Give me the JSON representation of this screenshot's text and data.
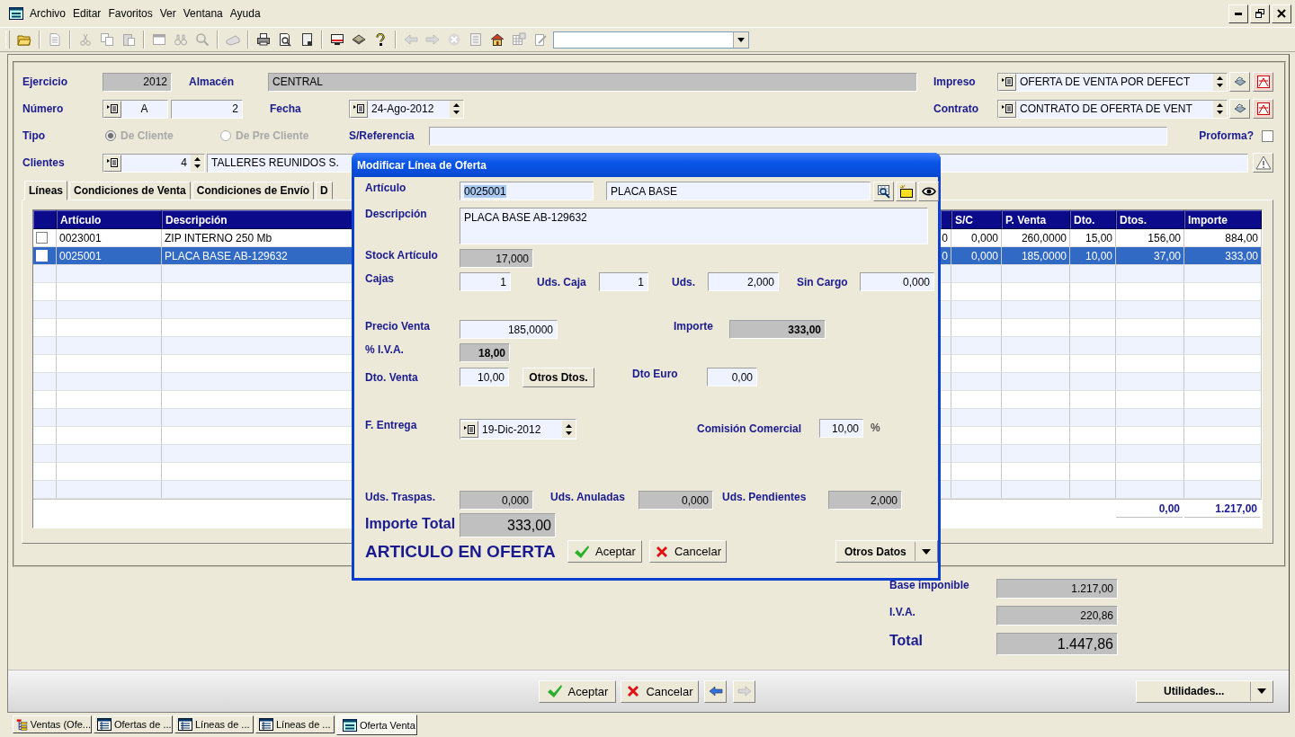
{
  "menu_bar": {
    "items": [
      "Archivo",
      "Editar",
      "Favoritos",
      "Ver",
      "Ventana",
      "Ayuda"
    ]
  },
  "toolbar": {
    "groups": [
      [
        {
          "kind": "open",
          "disabled": false
        }
      ],
      [
        {
          "kind": "doc",
          "disabled": true
        }
      ],
      [
        {
          "kind": "cut",
          "disabled": true
        },
        {
          "kind": "copy",
          "disabled": true
        },
        {
          "kind": "paste",
          "disabled": true
        }
      ],
      [
        {
          "kind": "window",
          "disabled": true
        },
        {
          "kind": "replace",
          "disabled": true
        },
        {
          "kind": "search",
          "disabled": true
        }
      ],
      [
        {
          "kind": "scanner",
          "disabled": true
        }
      ],
      [
        {
          "kind": "print",
          "disabled": false
        },
        {
          "kind": "preview",
          "disabled": false
        },
        {
          "kind": "page",
          "disabled": false
        }
      ],
      [
        {
          "kind": "monitor",
          "disabled": false
        },
        {
          "kind": "book",
          "disabled": false
        },
        {
          "kind": "help",
          "disabled": false
        }
      ],
      [
        {
          "kind": "back",
          "disabled": true
        },
        {
          "kind": "forward",
          "disabled": true
        },
        {
          "kind": "stop",
          "disabled": true
        },
        {
          "kind": "refresh",
          "disabled": true
        },
        {
          "kind": "home",
          "disabled": false
        },
        {
          "kind": "grid",
          "disabled": true
        },
        {
          "kind": "edit",
          "disabled": true
        }
      ]
    ]
  },
  "header": {
    "ejercicio": {
      "label": "Ejercicio",
      "value": "2012"
    },
    "almacen": {
      "label": "Almacén",
      "value": "CENTRAL"
    },
    "impreso": {
      "label": "Impreso",
      "value": "OFERTA DE VENTA POR DEFECT"
    },
    "numero": {
      "label": "Número",
      "serie": "A",
      "value": "2"
    },
    "fecha": {
      "label": "Fecha",
      "value": "24-Ago-2012"
    },
    "contrato": {
      "label": "Contrato",
      "value": "CONTRATO DE OFERTA DE VENT"
    },
    "tipo": {
      "label": "Tipo",
      "options": [
        {
          "label": "De Cliente",
          "selected": true,
          "disabled": true
        },
        {
          "label": "De Pre Cliente",
          "selected": false,
          "disabled": true
        }
      ]
    },
    "referencia": {
      "label": "S/Referencia"
    },
    "proforma": {
      "label": "Proforma?",
      "checked": false
    },
    "clientes": {
      "label": "Clientes",
      "code": "4",
      "name": "TALLERES REUNIDOS S."
    }
  },
  "tabs": [
    {
      "label": "Líneas",
      "selected": true
    },
    {
      "label": "Condiciones de Venta",
      "selected": false
    },
    {
      "label": "Condiciones de Envío",
      "selected": false
    },
    {
      "label": "D",
      "selected": false
    }
  ],
  "table": {
    "columns": [
      {
        "kind": "full",
        "label": "Artículo"
      },
      {
        "kind": "full",
        "label": "Descripción"
      },
      {
        "kind": "cut"
      },
      {
        "kind": "full",
        "label": "S/C"
      },
      {
        "kind": "full",
        "label": "P. Venta"
      },
      {
        "kind": "full",
        "label": "Dto."
      },
      {
        "kind": "full",
        "label": "Dtos."
      },
      {
        "kind": "full",
        "label": "Importe"
      }
    ],
    "rows": [
      {
        "checked": false,
        "selected": false,
        "cells": [
          "0023001",
          "ZIP INTERNO 250 Mb",
          "0",
          "0,000",
          "260,0000",
          "15,00",
          "156,00",
          "884,00"
        ]
      },
      {
        "checked": false,
        "selected": true,
        "cells": [
          "0025001",
          "PLACA BASE AB-129632",
          "0",
          "0,000",
          "185,0000",
          "10,00",
          "37,00",
          "333,00"
        ]
      }
    ],
    "footer": {
      "dtos": "0,00",
      "importe": "1.217,00"
    }
  },
  "dialog": {
    "title": "Modificar Línea de Oferta",
    "articulo": {
      "label": "Artículo",
      "code": "0025001",
      "code_highlighted": true,
      "name": "PLACA BASE"
    },
    "descripcion": {
      "label": "Descripción",
      "value": "PLACA BASE AB-129632"
    },
    "stock": {
      "label": "Stock Artículo",
      "value": "17,000"
    },
    "cajas": {
      "label": "Cajas",
      "value": "1"
    },
    "uds_caja": {
      "label": "Uds. Caja",
      "value": "1"
    },
    "uds": {
      "label": "Uds.",
      "value": "2,000"
    },
    "sin_cargo": {
      "label": "Sin Cargo",
      "value": "0,000"
    },
    "precio_venta": {
      "label": "Precio Venta",
      "value": "185,0000"
    },
    "importe": {
      "label": "Importe",
      "value": "333,00"
    },
    "iva": {
      "label": "% I.V.A.",
      "value": "18,00"
    },
    "dto_venta": {
      "label": "Dto. Venta",
      "value": "10,00"
    },
    "otros_dtos": "Otros Dtos.",
    "dto_euro": {
      "label": "Dto Euro",
      "value": "0,00"
    },
    "f_entrega": {
      "label": "F. Entrega",
      "value": "19-Dic-2012"
    },
    "comision": {
      "label": "Comisión Comercial",
      "value": "10,00",
      "unit": "%"
    },
    "uds_traspas": {
      "label": "Uds. Traspas.",
      "value": "0,000"
    },
    "uds_anuladas": {
      "label": "Uds. Anuladas",
      "value": "0,000"
    },
    "uds_pendientes": {
      "label": "Uds. Pendientes",
      "value": "2,000"
    },
    "importe_total": {
      "label": "Importe Total",
      "value": "333,00"
    },
    "banner": "ARTICULO EN OFERTA",
    "accept": "Aceptar",
    "cancel": "Cancelar",
    "otros_datos": "Otros Datos"
  },
  "totals": [
    {
      "kind": "line",
      "label": "Base imponible",
      "value": "1.217,00"
    },
    {
      "kind": "line",
      "label": "I.V.A.",
      "value": "220,86"
    },
    {
      "kind": "grand",
      "label": "Total",
      "value": "1.447,86"
    }
  ],
  "buttons": {
    "accept": "Aceptar",
    "cancel": "Cancelar",
    "utilities": "Utilidades..."
  },
  "nav_buttons": [
    {
      "kind": "back",
      "disabled": false
    },
    {
      "kind": "forward",
      "disabled": true
    }
  ],
  "taskbar": [
    {
      "kind": "tree",
      "label": "Ventas (Ofe...",
      "selected": false
    },
    {
      "kind": "grid",
      "label": "Ofertas de ...",
      "selected": false
    },
    {
      "kind": "grid",
      "label": "Líneas de ...",
      "selected": false
    },
    {
      "kind": "grid",
      "label": "Líneas de ...",
      "selected": false
    },
    {
      "kind": "form",
      "label": "Oferta Venta",
      "selected": true
    }
  ]
}
